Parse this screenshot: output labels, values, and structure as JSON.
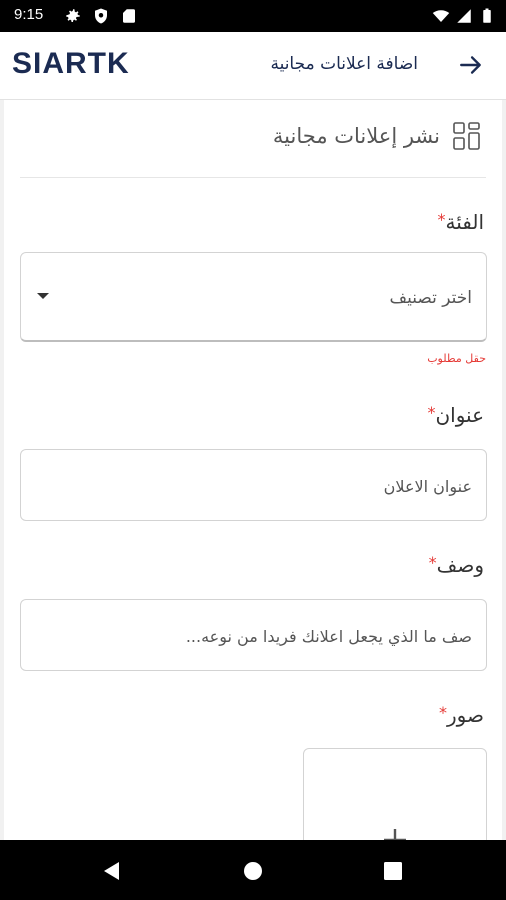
{
  "status_bar": {
    "time": "9:15",
    "icons": [
      "gear-icon",
      "shield-icon",
      "sd-card-icon",
      "wifi-icon",
      "signal-icon",
      "battery-icon"
    ]
  },
  "app_bar": {
    "logo": "SIARTK",
    "title": "اضافة اعلانات مجانية",
    "back_icon": "arrow-right-icon"
  },
  "form": {
    "header_title": "نشر إعلانات مجانية",
    "header_icon": "grid-icon",
    "category": {
      "label": "الفئة",
      "required_mark": "*",
      "placeholder": "اختر تصنيف",
      "error": "حقل مطلوب"
    },
    "title_field": {
      "label": "عنوان",
      "required_mark": "*",
      "placeholder": "عنوان الاعلان"
    },
    "description": {
      "label": "وصف",
      "required_mark": "*",
      "placeholder": "صف ما الذي يجعل اعلانك فريدا من نوعه..."
    },
    "images": {
      "label": "صور",
      "required_mark": "*",
      "add_icon": "plus-icon"
    }
  },
  "colors": {
    "brand": "#1b2b52",
    "required": "#e53935",
    "background": "#f1f1f1"
  },
  "nav_bar": {
    "icons": [
      "back-triangle-icon",
      "home-circle-icon",
      "recents-square-icon"
    ]
  }
}
